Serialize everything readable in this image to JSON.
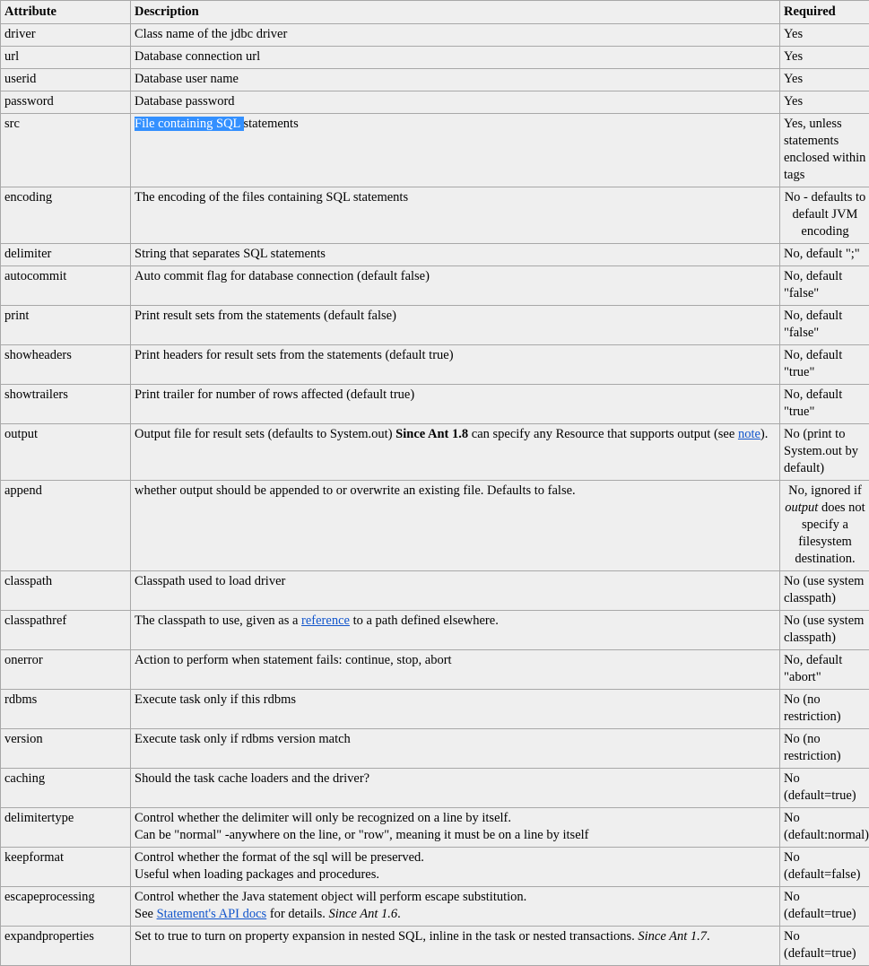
{
  "headers": {
    "attribute": "Attribute",
    "description": "Description",
    "required": "Required"
  },
  "rows": [
    {
      "attr": "driver",
      "desc": "Class name of the jdbc driver",
      "req": "Yes"
    },
    {
      "attr": "url",
      "desc": "Database connection url",
      "req": "Yes"
    },
    {
      "attr": "userid",
      "desc": "Database user name",
      "req": "Yes"
    },
    {
      "attr": "password",
      "desc": "Database password",
      "req": "Yes"
    },
    {
      "attr": "src",
      "desc_selected": "File containing SQL ",
      "desc_rest": "statements",
      "req": "Yes, unless statements enclosed within tags"
    },
    {
      "attr": "encoding",
      "desc": "The encoding of the files containing SQL statements",
      "req": "No - defaults to default JVM encoding"
    },
    {
      "attr": "delimiter",
      "desc": "String that separates SQL statements",
      "req": "No, default \";\""
    },
    {
      "attr": "autocommit",
      "desc": "Auto commit flag for database connection (default false)",
      "req": "No, default \"false\""
    },
    {
      "attr": "print",
      "desc": "Print result sets from the statements (default false)",
      "req": "No, default \"false\""
    },
    {
      "attr": "showheaders",
      "desc": "Print headers for result sets from the statements (default true)",
      "req": "No, default \"true\""
    },
    {
      "attr": "showtrailers",
      "desc": "Print trailer for number of rows affected (default true)",
      "req": "No, default \"true\""
    },
    {
      "attr": "output",
      "desc_pre": "Output file for result sets (defaults to System.out) ",
      "desc_since": "Since Ant 1.8",
      "desc_mid": " can specify any Resource that supports output (see ",
      "desc_link": "note",
      "desc_post": ").",
      "req": "No (print to System.out by default)"
    },
    {
      "attr": "append",
      "desc": "whether output should be appended to or overwrite an existing file. Defaults to false.",
      "req_pre": "No, ignored if ",
      "req_em": "output",
      "req_post": " does not specify a filesystem destination."
    },
    {
      "attr": "classpath",
      "desc": "Classpath used to load driver",
      "req": "No (use system classpath)"
    },
    {
      "attr": "classpathref",
      "desc_pre": "The classpath to use, given as a ",
      "desc_link": "reference",
      "desc_post": " to a path defined elsewhere.",
      "req": "No (use system classpath)"
    },
    {
      "attr": "onerror",
      "desc": "Action to perform when statement fails: continue, stop, abort",
      "req": "No, default \"abort\""
    },
    {
      "attr": "rdbms",
      "desc": "Execute task only if this rdbms",
      "req": "No (no restriction)"
    },
    {
      "attr": "version",
      "desc": "Execute task only if rdbms version match",
      "req": "No (no restriction)"
    },
    {
      "attr": "caching",
      "desc": "Should the task cache loaders and the driver?",
      "req": "No (default=true)"
    },
    {
      "attr": "delimitertype",
      "desc_line1": "Control whether the delimiter will only be recognized on a line by itself.",
      "desc_line2": "Can be \"normal\" -anywhere on the line, or \"row\", meaning it must be on a line by itself",
      "req": "No (default:normal)"
    },
    {
      "attr": "keepformat",
      "desc_line1": "Control whether the format of the sql will be preserved.",
      "desc_line2": "Useful when loading packages and procedures.",
      "req": "No (default=false)"
    },
    {
      "attr": "escapeprocessing",
      "desc_line1": "Control whether the Java statement object will perform escape substitution.",
      "desc_line2_pre": "See ",
      "desc_link": "Statement's API docs",
      "desc_line2_mid": " for details. ",
      "desc_since": "Since Ant 1.6",
      "desc_post": ".",
      "req": "No (default=true)"
    },
    {
      "attr": "expandproperties",
      "desc_pre": "Set to true to turn on property expansion in nested SQL, inline in the task or nested transactions. ",
      "desc_since": "Since Ant 1.7",
      "desc_post": ".",
      "req": "No (default=true)"
    }
  ]
}
